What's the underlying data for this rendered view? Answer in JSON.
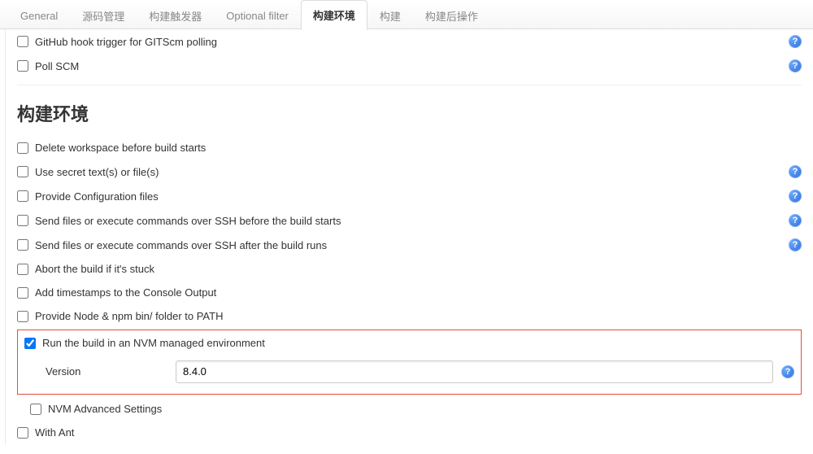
{
  "tabs": [
    {
      "label": "General"
    },
    {
      "label": "源码管理"
    },
    {
      "label": "构建触发器"
    },
    {
      "label": "Optional filter"
    },
    {
      "label": "构建环境"
    },
    {
      "label": "构建"
    },
    {
      "label": "构建后操作"
    }
  ],
  "active_tab_index": 4,
  "trigger_options": [
    {
      "label": "GitHub hook trigger for GITScm polling",
      "checked": false,
      "help": true
    },
    {
      "label": "Poll SCM",
      "checked": false,
      "help": true
    }
  ],
  "section": {
    "title": "构建环境"
  },
  "env_options": [
    {
      "label": "Delete workspace before build starts",
      "checked": false,
      "help": false
    },
    {
      "label": "Use secret text(s) or file(s)",
      "checked": false,
      "help": true
    },
    {
      "label": "Provide Configuration files",
      "checked": false,
      "help": true
    },
    {
      "label": "Send files or execute commands over SSH before the build starts",
      "checked": false,
      "help": true
    },
    {
      "label": "Send files or execute commands over SSH after the build runs",
      "checked": false,
      "help": true
    },
    {
      "label": "Abort the build if it's stuck",
      "checked": false,
      "help": false
    },
    {
      "label": "Add timestamps to the Console Output",
      "checked": false,
      "help": false
    },
    {
      "label": "Provide Node & npm bin/ folder to PATH",
      "checked": false,
      "help": false
    }
  ],
  "nvm": {
    "label": "Run the build in an NVM managed environment",
    "checked": true,
    "version_label": "Version",
    "version_value": "8.4.0"
  },
  "post_options": [
    {
      "label": "NVM Advanced Settings",
      "checked": false
    },
    {
      "label": "With Ant",
      "checked": false
    }
  ],
  "help_glyph": "?"
}
